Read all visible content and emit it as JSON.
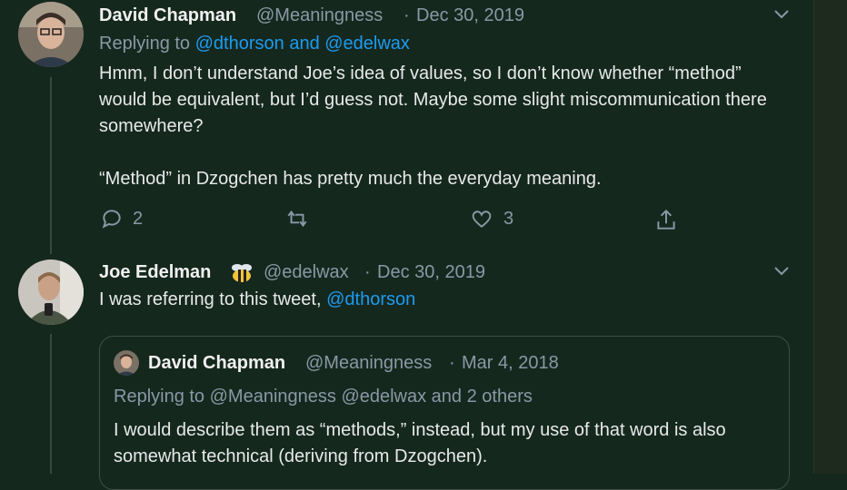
{
  "tweet1": {
    "author_name": "David Chapman",
    "handle": "@Meaningness",
    "separator": "·",
    "date": "Dec 30, 2019",
    "replying_prefix": "Replying to",
    "replying_to": "@dthorson and @edelwax",
    "text_p1": "Hmm, I don’t understand Joe’s idea of values, so I don’t know whether “method” would be equivalent, but I’d guess not. Maybe some slight miscommunication there somewhere?",
    "text_p2": "“Method” in Dzogchen has pretty much the everyday meaning.",
    "reply_count": "2",
    "retweet_count": "",
    "like_count": "3"
  },
  "tweet2": {
    "author_name": "Joe Edelman",
    "handle": "@edelwax",
    "separator": "·",
    "date": "Dec 30, 2019",
    "text": "I was referring to this tweet, ",
    "mention": "@dthorson"
  },
  "quoted": {
    "author_name": "David Chapman",
    "handle": "@Meaningness",
    "separator": "·",
    "date": "Mar 4, 2018",
    "replying_line": "Replying to @Meaningness @edelwax and 2 others",
    "text": "I would describe them as “methods,” instead, but my use of that word is also somewhat technical (deriving from Dzogchen)."
  },
  "icons": [
    "reply-icon",
    "retweet-icon",
    "like-icon",
    "share-icon",
    "chevron-down-icon",
    "bee-icon"
  ],
  "colors": {
    "background": "#15281e",
    "link": "#1d9bf0",
    "muted": "#8b98a5",
    "text": "#e7e9ea"
  }
}
